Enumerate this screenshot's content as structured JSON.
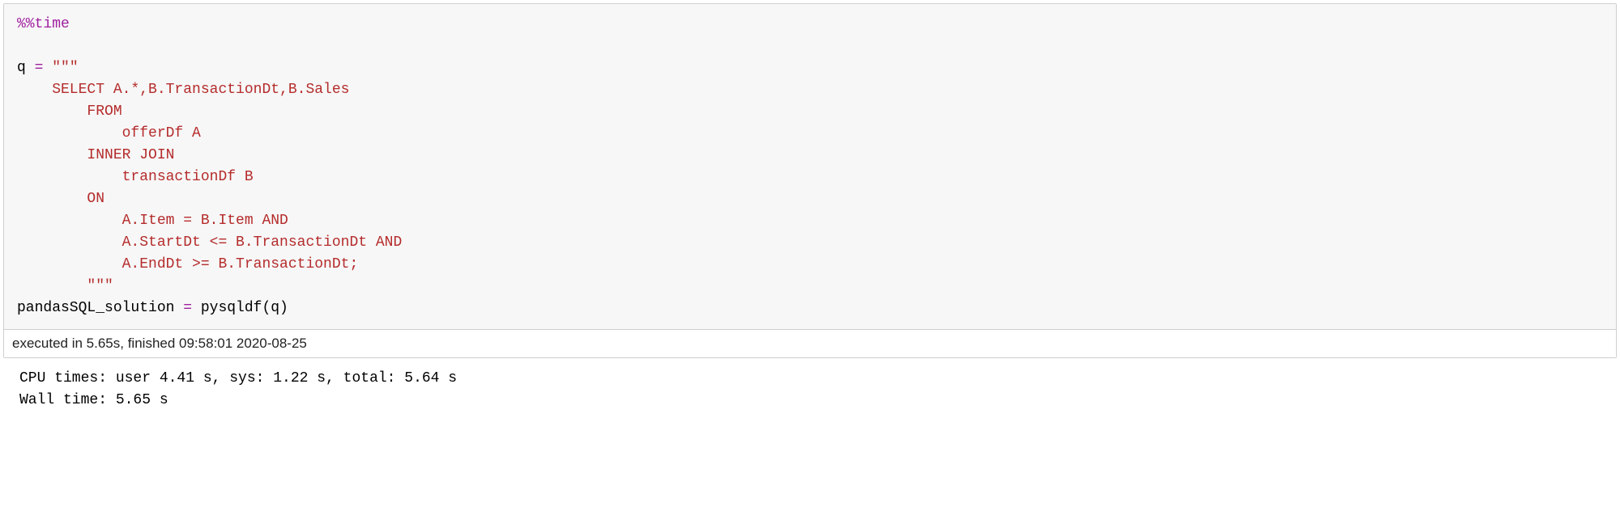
{
  "cell": {
    "magic": "%%time",
    "lines": {
      "l1a": "q ",
      "l1b": "= ",
      "l1c": "\"\"\"",
      "l2": "    SELECT A.*,B.TransactionDt,B.Sales",
      "l3": "        FROM",
      "l4": "            offerDf A",
      "l5": "        INNER JOIN",
      "l6": "            transactionDf B",
      "l7": "        ON",
      "l8": "            A.Item = B.Item AND",
      "l9": "            A.StartDt <= B.TransactionDt AND",
      "l10": "            A.EndDt >= B.TransactionDt;",
      "l11": "        \"\"\"",
      "l12a": "pandasSQL_solution ",
      "l12b": "= ",
      "l12c": "pysqldf(q)"
    },
    "exec_info": "executed in 5.65s, finished 09:58:01 2020-08-25",
    "output_line1": "CPU times: user 4.41 s, sys: 1.22 s, total: 5.64 s",
    "output_line2": "Wall time: 5.65 s"
  }
}
